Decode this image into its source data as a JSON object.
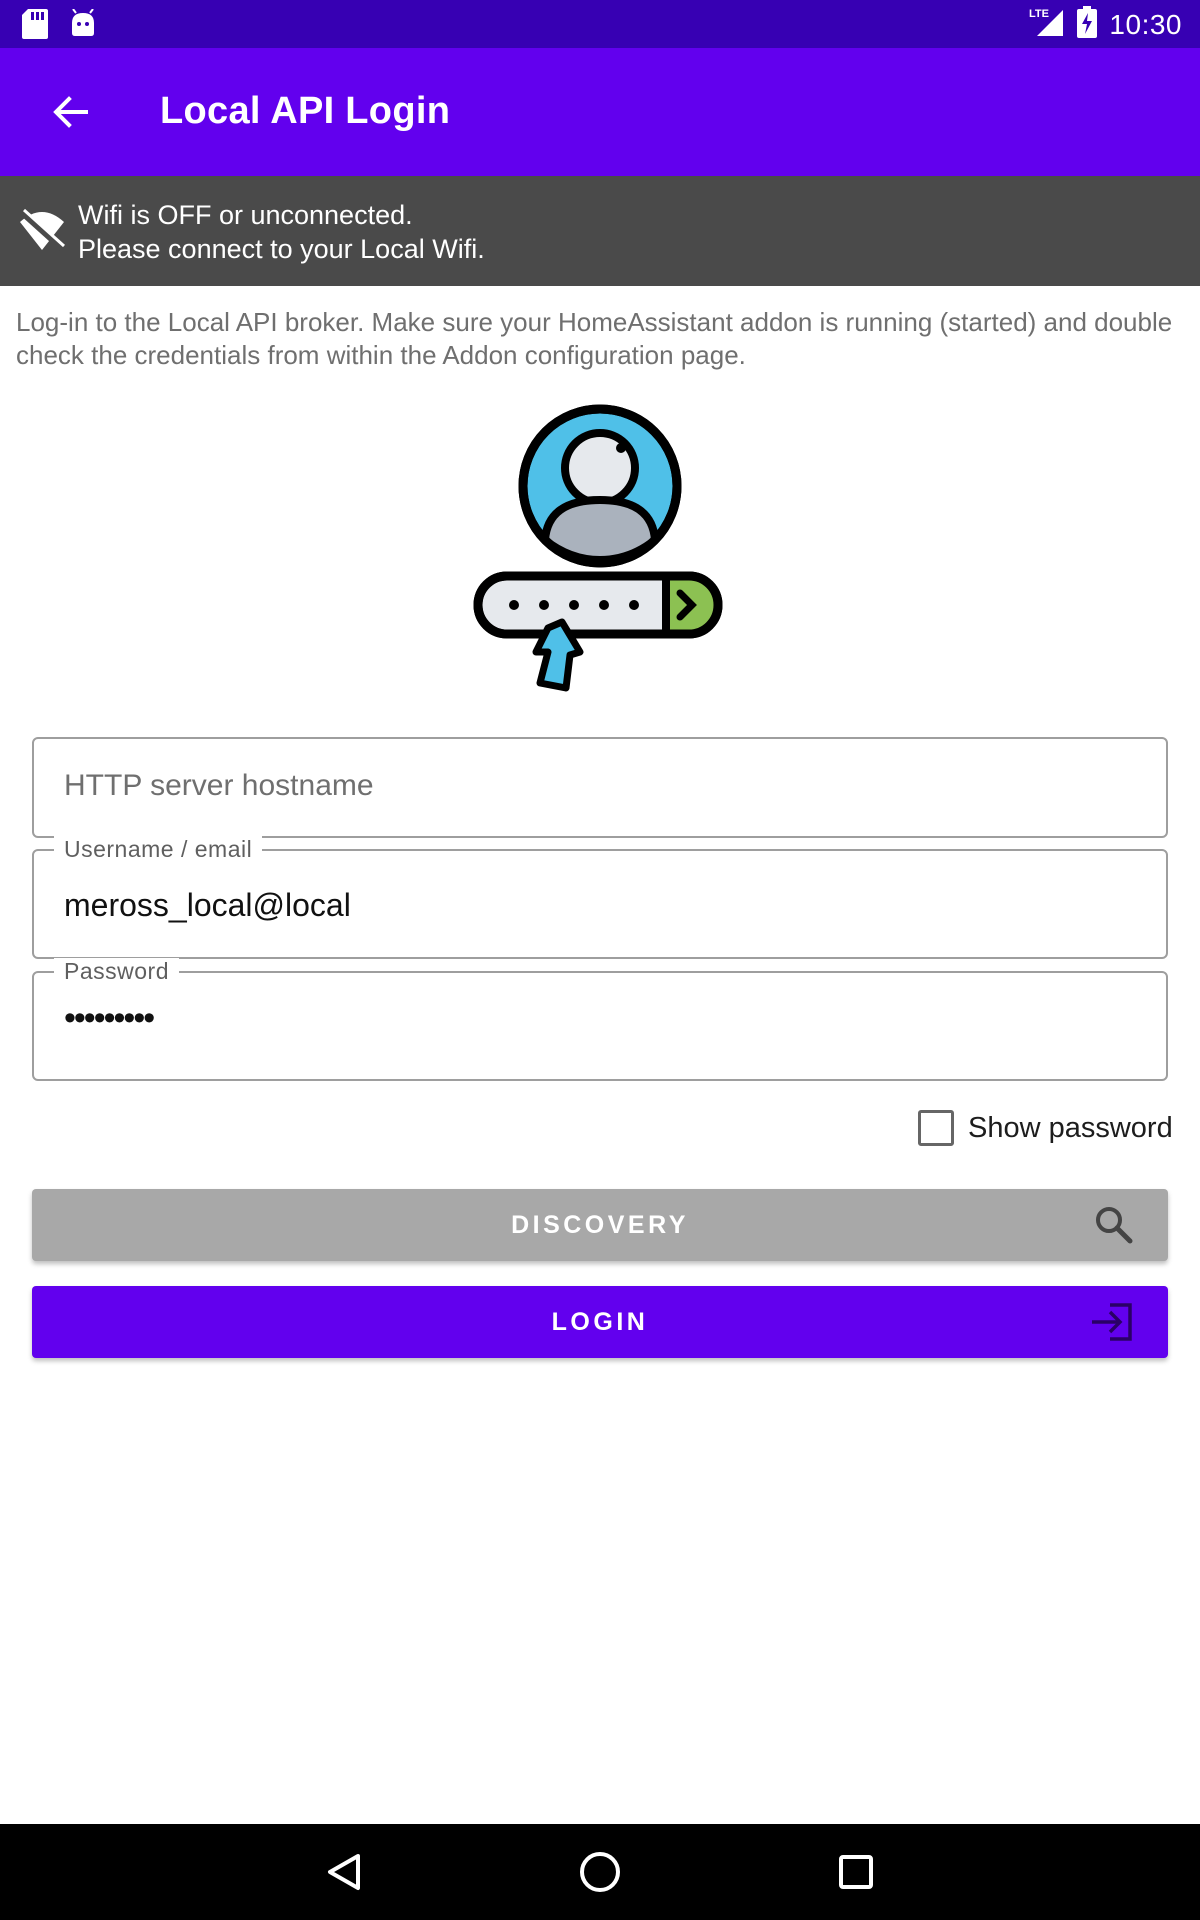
{
  "status_bar": {
    "time": "10:30",
    "left_icons": [
      "sd-card-icon",
      "android-debug-icon"
    ],
    "right_icons": [
      "lte-signal-icon",
      "battery-charging-icon"
    ],
    "network_label": "LTE"
  },
  "app_bar": {
    "title": "Local API Login",
    "back_icon": "arrow-back-icon",
    "background": "#6200ee"
  },
  "wifi_banner": {
    "line1": "Wifi is OFF or unconnected.",
    "line2": "Please connect to your Local Wifi.",
    "icon": "wifi-off-icon",
    "background": "#4a4a4a"
  },
  "intro_text": "Log-in to the Local API broker. Make sure your HomeAssistant addon is running (started) and double check the credentials from within the Addon configuration page.",
  "form": {
    "hostname": {
      "placeholder": "HTTP server hostname",
      "value": ""
    },
    "username": {
      "label": "Username / email",
      "value": "meross_local@local"
    },
    "password": {
      "label": "Password",
      "masked_value": "•••••••••"
    },
    "show_password": {
      "label": "Show password",
      "checked": false
    }
  },
  "buttons": {
    "discovery": {
      "label": "DISCOVERY",
      "icon": "search-icon",
      "color": "#a8a8a8"
    },
    "login": {
      "label": "LOGIN",
      "icon": "login-icon",
      "color": "#6200ee"
    }
  },
  "nav_bar": {
    "icons": [
      "back-triangle-icon",
      "home-circle-icon",
      "recents-square-icon"
    ]
  }
}
